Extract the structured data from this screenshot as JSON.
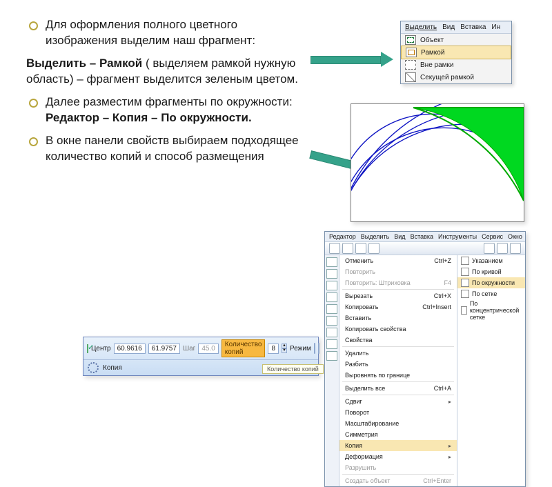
{
  "text": {
    "bullet1": "Для оформления полного цветного изображения выделим наш фрагмент:",
    "para1_lead": "Выделить – Рамкой",
    "para1_rest": " ( выделяем рамкой нужную область) – фрагмент выделится зеленым цветом.",
    "bullet2_a": "Далее разместим фрагменты по окружности: ",
    "bullet2_b": "Редактор – Копия – По окружности.",
    "bullet3": "В окне панели свойств выбираем подходящее количество копий и способ размещения"
  },
  "menu1": {
    "tabs": [
      "Выделить",
      "Вид",
      "Вставка",
      "Ин"
    ],
    "items": [
      {
        "icon": "obj",
        "label": "Объект"
      },
      {
        "icon": "frame",
        "label": "Рамкой",
        "selected": true
      },
      {
        "icon": "out",
        "label": "Вне рамки"
      },
      {
        "icon": "sec",
        "label": "Секущей рамкой"
      }
    ]
  },
  "editor": {
    "menubar": [
      "Редактор",
      "Выделить",
      "Вид",
      "Вставка",
      "Инструменты",
      "Сервис",
      "Окно"
    ],
    "drop": [
      {
        "label": "Отменить",
        "short": "Ctrl+Z"
      },
      {
        "label": "Повторить",
        "short": "",
        "disabled": true
      },
      {
        "label": "Повторить: Штриховка",
        "short": "F4",
        "disabled": true
      },
      {
        "sep": true
      },
      {
        "label": "Вырезать",
        "short": "Ctrl+X"
      },
      {
        "label": "Копировать",
        "short": "Ctrl+Insert"
      },
      {
        "label": "Вставить",
        "short": ""
      },
      {
        "label": "Копировать свойства",
        "short": ""
      },
      {
        "label": "Свойства",
        "short": ""
      },
      {
        "sep": true
      },
      {
        "label": "Удалить",
        "short": ""
      },
      {
        "label": "Разбить",
        "short": ""
      },
      {
        "label": "Выровнять по границе",
        "short": ""
      },
      {
        "sep": true
      },
      {
        "label": "Выделить все",
        "short": "Ctrl+A"
      },
      {
        "sep": true
      },
      {
        "label": "Сдвиг",
        "short": "",
        "arrow": true
      },
      {
        "label": "Поворот",
        "short": ""
      },
      {
        "label": "Масштабирование",
        "short": ""
      },
      {
        "label": "Симметрия",
        "short": ""
      },
      {
        "label": "Копия",
        "short": "",
        "arrow": true,
        "selected": true
      },
      {
        "label": "Деформация",
        "short": "",
        "arrow": true
      },
      {
        "label": "Разрушить",
        "short": "",
        "disabled": true
      },
      {
        "sep": true
      },
      {
        "label": "Создать объект",
        "short": "Ctrl+Enter",
        "disabled": true
      }
    ],
    "sub": [
      {
        "label": "Указанием"
      },
      {
        "label": "По кривой"
      },
      {
        "label": "По окружности",
        "selected": true
      },
      {
        "label": "По сетке"
      },
      {
        "label": "По концентрической сетке"
      }
    ]
  },
  "propbar": {
    "center_label": "Центр",
    "center_x": "60.9616",
    "center_y": "61.9757",
    "step_label": "Шаг",
    "step_value": "45.0",
    "count_label": "Количество копий",
    "count_value": "8",
    "mode_label": "Режим",
    "copy_label": "Копия",
    "hint": "Количество копий"
  }
}
